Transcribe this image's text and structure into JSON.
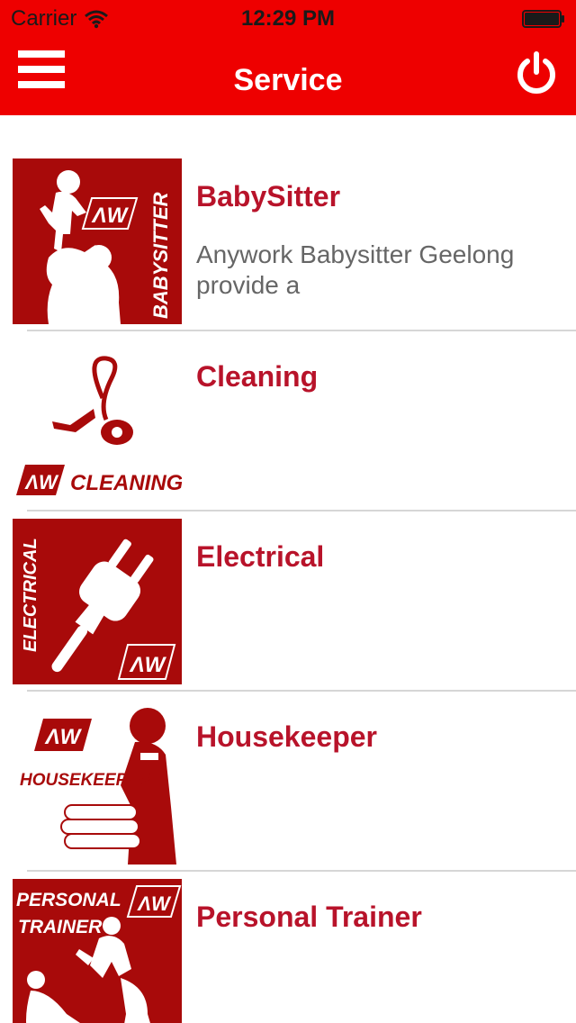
{
  "status_bar": {
    "carrier": "Carrier",
    "time": "12:29 PM"
  },
  "nav": {
    "title": "Service",
    "menu_icon": "hamburger-menu-icon",
    "power_icon": "power-icon"
  },
  "colors": {
    "brand_red": "#ee0000",
    "title_red": "#b8132a",
    "tile_red": "#a80a0a"
  },
  "services": [
    {
      "title": "BabySitter",
      "description": "Anywork Babysitter Geelong provide a",
      "logo_text": "BABYSITTER",
      "logo_mark": "AW"
    },
    {
      "title": "Cleaning",
      "description": "",
      "logo_text": "CLEANING",
      "logo_mark": "AW"
    },
    {
      "title": "Electrical",
      "description": "",
      "logo_text": "ELECTRICAL",
      "logo_mark": "AW"
    },
    {
      "title": "Housekeeper",
      "description": "",
      "logo_text": "HOUSEKEEPER",
      "logo_mark": "AW"
    },
    {
      "title": "Personal Trainer",
      "description": "",
      "logo_text_line1": "PERSONAL",
      "logo_text_line2": "TRAINER",
      "logo_mark": "AW"
    }
  ]
}
